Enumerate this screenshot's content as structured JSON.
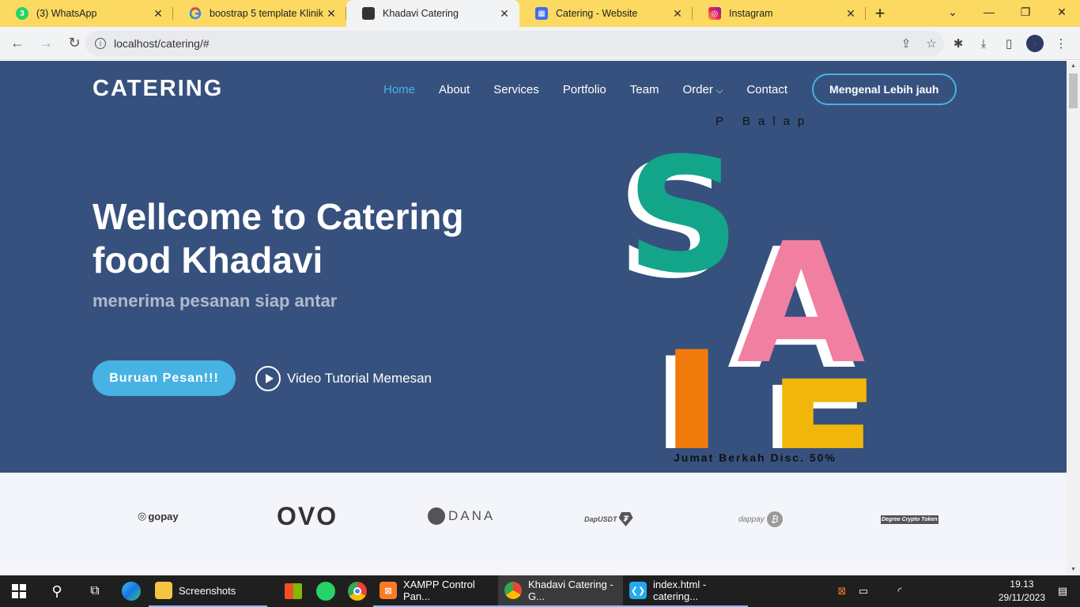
{
  "browser": {
    "tabs": [
      {
        "title": "(3) WhatsApp",
        "icon": "whatsapp-icon",
        "badge": "3"
      },
      {
        "title": "boostrap 5 template Klinik -",
        "icon": "google-icon"
      },
      {
        "title": "Khadavi Catering",
        "icon": "site-icon"
      },
      {
        "title": "Catering - Website",
        "icon": "calendar-icon"
      },
      {
        "title": "Instagram",
        "icon": "instagram-icon"
      }
    ],
    "url": "localhost/catering/#"
  },
  "site": {
    "logo": "CATERING",
    "nav": [
      "Home",
      "About",
      "Services",
      "Portfolio",
      "Team",
      "Order",
      "Contact"
    ],
    "cta": "Mengenal Lebih jauh",
    "hero_title": "Wellcome to Catering food Khadavi",
    "hero_subtitle": "menerima pesanan siap antar",
    "order_button": "Buruan Pesan!!!",
    "video_link": "Video Tutorial Memesan",
    "sale_top": "P Balap",
    "sale_letters": [
      "S",
      "A",
      "L",
      "E"
    ],
    "sale_bottom": "Jumat Berkah Disc. 50%",
    "clients": [
      "gopay",
      "OVO",
      "DANA",
      "DapUSDT",
      "dappay",
      "Degree Crypto Token"
    ]
  },
  "taskbar": {
    "apps": [
      {
        "label": "Screenshots",
        "icon": "folder-icon"
      },
      {
        "label": "XAMPP Control Pan...",
        "icon": "xampp-icon"
      },
      {
        "label": "Khadavi Catering - G...",
        "icon": "chrome-icon"
      },
      {
        "label": "index.html - catering...",
        "icon": "vscode-icon"
      }
    ],
    "time": "19.13",
    "date": "29/11/2023"
  },
  "colors": {
    "hero_bg": "#37517e",
    "accent": "#47b2e4",
    "tabbar": "#fcd960",
    "sale_s": "#12a58a",
    "sale_a": "#f07fa2",
    "sale_l": "#f07b0c",
    "sale_e": "#f0b70a"
  }
}
